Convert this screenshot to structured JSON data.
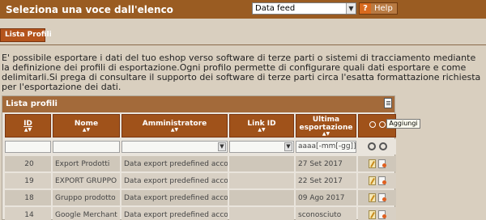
{
  "header": {
    "title": "Seleziona una voce dall'elenco",
    "select_value": "Data feed",
    "help_label": "Help"
  },
  "tab": {
    "label": "Lista Profili"
  },
  "description": "E' possibile esportare i dati del tuo eshop verso software di terze parti o sistemi di tracciamento mediante la definizione dei profili di esportazione.Ogni profilo permette di configurare quali dati esportare e come delimitarli.Si prega di consultare il supporto dei software di terze parti circa l'esatta formattazione richiesta per l'esportazione dei dati.",
  "panel": {
    "title": "Lista profili",
    "tooltip": "Aggiungi"
  },
  "table": {
    "headers": {
      "id": "ID",
      "name": "Nome",
      "admin": "Amministratore",
      "link": "Link ID",
      "last_export": "Ultima esportazione"
    },
    "date_placeholder": "aaaa[-mm[-gg]]",
    "rows": [
      {
        "id": "20",
        "name": "Export Prodotti",
        "admin": "Data export predefined account",
        "link": "",
        "date": "27 Set 2017"
      },
      {
        "id": "19",
        "name": "EXPORT GRUPPO",
        "admin": "Data export predefined account",
        "link": "",
        "date": "22 Set 2017"
      },
      {
        "id": "18",
        "name": "Gruppo prodotto",
        "admin": "Data export predefined account",
        "link": "",
        "date": "09 Ago 2017"
      },
      {
        "id": "14",
        "name": "Google Merchant",
        "admin": "Data export predefined account",
        "link": "",
        "date": "sconosciuto"
      }
    ]
  },
  "colors": {
    "topbar": "#9a5c22",
    "header_cell": "#a0521a",
    "background": "#d9cfbf",
    "tab": "#b4541c"
  },
  "icons": [
    "help-icon",
    "add-icon",
    "filter-icon",
    "search-icon",
    "edit-icon",
    "delete-icon"
  ]
}
